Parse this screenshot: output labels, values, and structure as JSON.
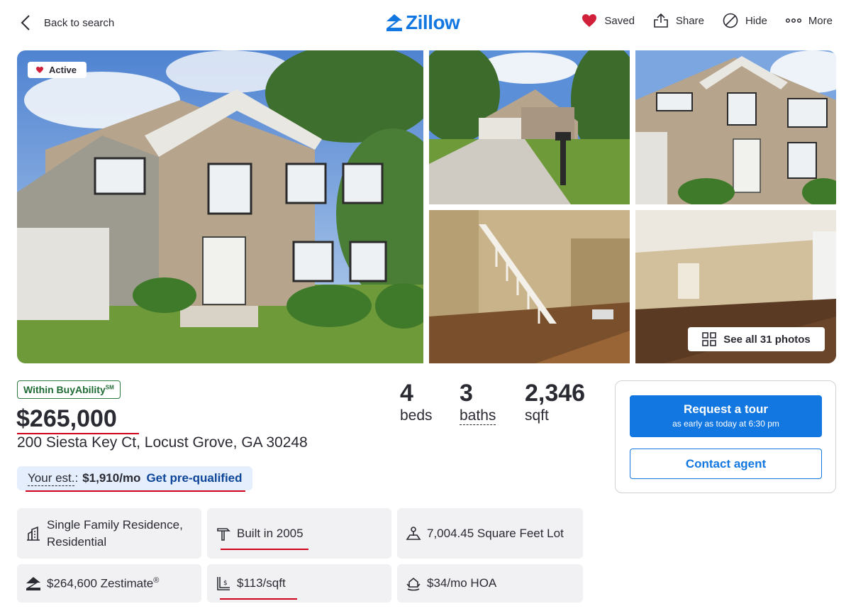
{
  "header": {
    "back_label": "Back to search",
    "logo_text": "Zillow",
    "actions": {
      "saved": "Saved",
      "share": "Share",
      "hide": "Hide",
      "more": "More"
    }
  },
  "gallery": {
    "status_badge": "Active",
    "see_all_label": "See all 31 photos"
  },
  "listing": {
    "buyability_label": "Within BuyAbility",
    "buyability_mark": "SM",
    "price": "$265,000",
    "address": "200 Siesta Key Ct, Locust Grove, GA 30248",
    "beds": {
      "value": "4",
      "label": "beds"
    },
    "baths": {
      "value": "3",
      "label": "baths"
    },
    "sqft": {
      "value": "2,346",
      "label": "sqft"
    },
    "estimate": {
      "label": "Your est.",
      "value": "$1,910/mo",
      "link": "Get pre-qualified"
    }
  },
  "facts": {
    "type_line1": "Single Family Residence,",
    "type_line2": "Residential",
    "built": "Built in 2005",
    "lot": "7,004.45 Square Feet Lot",
    "zestimate": "$264,600 Zestimate",
    "zestimate_mark": "®",
    "price_per_sqft": "$113/sqft",
    "hoa": "$34/mo HOA"
  },
  "contact_card": {
    "tour_title": "Request a tour",
    "tour_subtitle": "as early as today at 6:30 pm",
    "contact_label": "Contact agent"
  },
  "colors": {
    "brand_blue": "#1277e1",
    "saved_heart": "#d1213a",
    "buyability_green": "#1f6b34",
    "highlight_red": "#d0021b"
  }
}
